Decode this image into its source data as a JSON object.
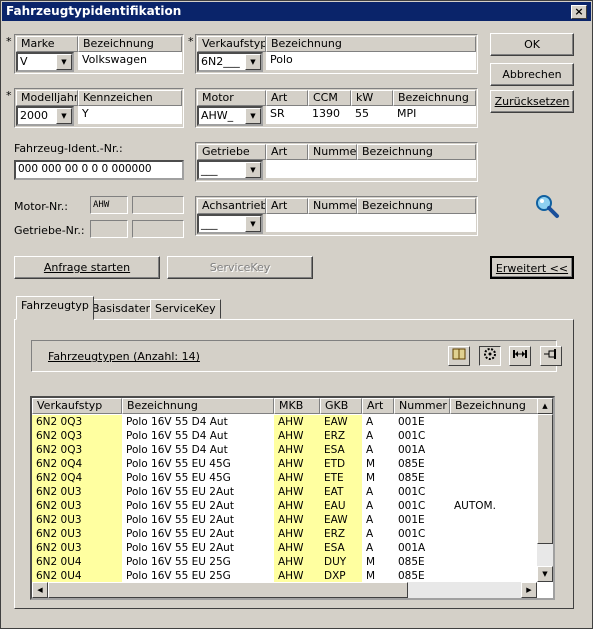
{
  "window": {
    "title": "Fahrzeugtypidentifikation",
    "close": "×"
  },
  "marke": {
    "star": "*",
    "hdr_marke": "Marke",
    "hdr_bez": "Bezeichnung",
    "value": "V",
    "desc": "Volkswagen"
  },
  "verkaufstyp": {
    "star": "*",
    "hdr_typ": "Verkaufstyp",
    "hdr_bez": "Bezeichnung",
    "value": "6N2___",
    "desc": "Polo"
  },
  "modelljahr": {
    "star": "*",
    "hdr_jahr": "Modelljahr",
    "hdr_kenn": "Kennzeichen",
    "value": "2000",
    "desc": "Y"
  },
  "motor": {
    "hdr_motor": "Motor",
    "hdr_art": "Art",
    "hdr_ccm": "CCM",
    "hdr_kw": "kW",
    "hdr_bez": "Bezeichnung",
    "value": "AHW_",
    "art": "SR",
    "ccm": "1390",
    "kw": "55",
    "desc": "MPI"
  },
  "fin": {
    "label": "Fahrzeug-Ident.-Nr.:",
    "value": "000 000 00 0 0 0 000000"
  },
  "getriebe": {
    "hdr_getriebe": "Getriebe",
    "hdr_art": "Art",
    "hdr_nummer": "Nummer",
    "hdr_bez": "Bezeichnung",
    "value": "___"
  },
  "achsantrieb": {
    "hdr_achs": "Achsantrieb",
    "hdr_art": "Art",
    "hdr_nummer": "Nummer",
    "hdr_bez": "Bezeichnung",
    "value": "___"
  },
  "motornr": {
    "label": "Motor-Nr.:",
    "value": "AHW"
  },
  "getriebenr": {
    "label": "Getriebe-Nr.:"
  },
  "buttons": {
    "ok": "OK",
    "abbrechen": "Abbrechen",
    "zuruecksetzen": "Zurücksetzen",
    "anfrage": "Anfrage starten",
    "servicekey": "ServiceKey",
    "erweitert": "Erweitert <<"
  },
  "tabs": [
    "Fahrzeugtyp",
    "Basisdaten",
    "ServiceKey"
  ],
  "panel": {
    "title": "Fahrzeugtypen (Anzahl: 14)"
  },
  "icons": {
    "search": "magnifier-icon",
    "tool1": "book-icon",
    "tool2": "gear-icon",
    "tool3": "width-icon",
    "tool4": "pin-icon"
  },
  "colors": {
    "titlebar": "#0a246a",
    "highlight": "#ffffa0"
  },
  "table": {
    "headers": [
      "Verkaufstyp",
      "Bezeichnung",
      "MKB",
      "GKB",
      "Art",
      "Nummer",
      "Bezeichnung"
    ],
    "rows": [
      [
        "6N2 0Q3",
        "Polo 16V 55 D4 Aut",
        "AHW",
        "EAW",
        "A",
        "001E",
        ""
      ],
      [
        "6N2 0Q3",
        "Polo 16V 55 D4 Aut",
        "AHW",
        "ERZ",
        "A",
        "001C",
        ""
      ],
      [
        "6N2 0Q3",
        "Polo 16V 55 D4 Aut",
        "AHW",
        "ESA",
        "A",
        "001A",
        ""
      ],
      [
        "6N2 0Q4",
        "Polo 16V 55 EU 45G",
        "AHW",
        "ETD",
        "M",
        "085E",
        ""
      ],
      [
        "6N2 0Q4",
        "Polo 16V 55 EU 45G",
        "AHW",
        "ETE",
        "M",
        "085E",
        ""
      ],
      [
        "6N2 0U3",
        "Polo 16V 55 EU 2Aut",
        "AHW",
        "EAT",
        "A",
        "001C",
        ""
      ],
      [
        "6N2 0U3",
        "Polo 16V 55 EU 2Aut",
        "AHW",
        "EAU",
        "A",
        "001C",
        "AUTOM."
      ],
      [
        "6N2 0U3",
        "Polo 16V 55 EU 2Aut",
        "AHW",
        "EAW",
        "A",
        "001E",
        ""
      ],
      [
        "6N2 0U3",
        "Polo 16V 55 EU 2Aut",
        "AHW",
        "ERZ",
        "A",
        "001C",
        ""
      ],
      [
        "6N2 0U3",
        "Polo 16V 55 EU 2Aut",
        "AHW",
        "ESA",
        "A",
        "001A",
        ""
      ],
      [
        "6N2 0U4",
        "Polo 16V 55 EU 25G",
        "AHW",
        "DUY",
        "M",
        "085E",
        ""
      ],
      [
        "6N2 0U4",
        "Polo 16V 55 EU 25G",
        "AHW",
        "DXP",
        "M",
        "085E",
        ""
      ]
    ]
  }
}
